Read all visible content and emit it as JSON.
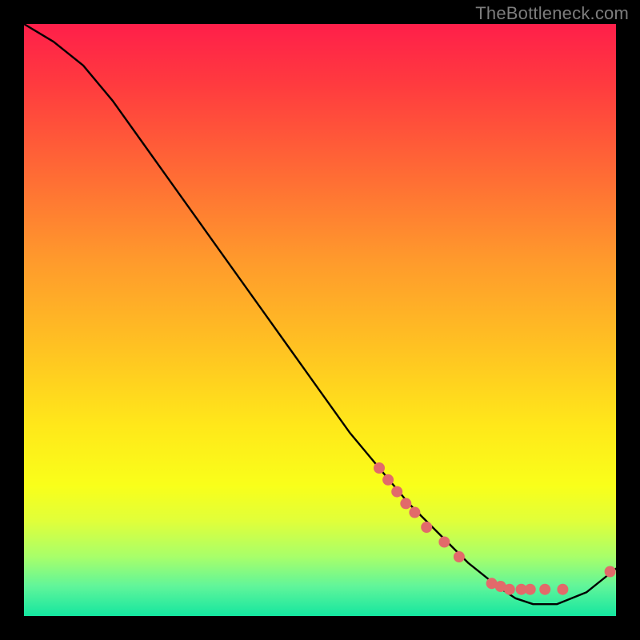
{
  "watermark": "TheBottleneck.com",
  "chart_data": {
    "type": "line",
    "title": "",
    "xlabel": "",
    "ylabel": "",
    "xlim": [
      0,
      100
    ],
    "ylim": [
      0,
      100
    ],
    "grid": false,
    "legend": false,
    "series": [
      {
        "name": "bottleneck-curve",
        "x": [
          0,
          5,
          10,
          15,
          20,
          25,
          30,
          35,
          40,
          45,
          50,
          55,
          60,
          65,
          70,
          75,
          80,
          83,
          86,
          90,
          95,
          100
        ],
        "y": [
          100,
          97,
          93,
          87,
          80,
          73,
          66,
          59,
          52,
          45,
          38,
          31,
          25,
          19,
          14,
          9,
          5,
          3,
          2,
          2,
          4,
          8
        ]
      }
    ],
    "markers": [
      {
        "x": 60.0,
        "y": 25.0
      },
      {
        "x": 61.5,
        "y": 23.0
      },
      {
        "x": 63.0,
        "y": 21.0
      },
      {
        "x": 64.5,
        "y": 19.0
      },
      {
        "x": 66.0,
        "y": 17.5
      },
      {
        "x": 68.0,
        "y": 15.0
      },
      {
        "x": 71.0,
        "y": 12.5
      },
      {
        "x": 73.5,
        "y": 10.0
      },
      {
        "x": 79.0,
        "y": 5.5
      },
      {
        "x": 80.5,
        "y": 5.0
      },
      {
        "x": 82.0,
        "y": 4.5
      },
      {
        "x": 84.0,
        "y": 4.5
      },
      {
        "x": 85.5,
        "y": 4.5
      },
      {
        "x": 88.0,
        "y": 4.5
      },
      {
        "x": 91.0,
        "y": 4.5
      },
      {
        "x": 99.0,
        "y": 7.5
      }
    ],
    "gradient_stops_pct": {
      "0": "#ff1f4a",
      "10": "#ff3a3f",
      "25": "#ff6a35",
      "40": "#ff9a2c",
      "55": "#ffc322",
      "68": "#ffe81a",
      "78": "#f9ff1a",
      "84": "#e0ff3a",
      "90": "#a8ff6a",
      "95": "#60f59a",
      "100": "#14e6a0"
    },
    "marker_color": "#e26a6a",
    "curve_color": "#000000"
  }
}
